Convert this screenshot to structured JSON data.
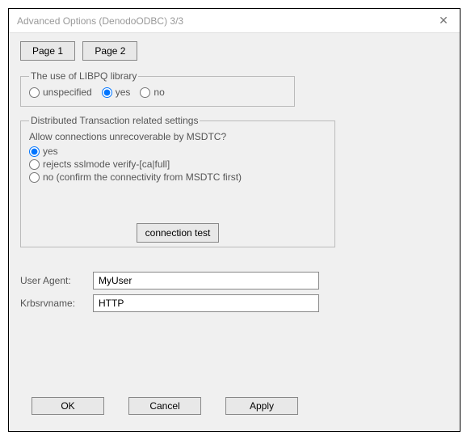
{
  "window": {
    "title": "Advanced Options (DenodoODBC) 3/3"
  },
  "pages": {
    "page1": "Page 1",
    "page2": "Page 2"
  },
  "libpq": {
    "legend": "The use of LIBPQ library",
    "opt_unspecified": "unspecified",
    "opt_yes": "yes",
    "opt_no": "no",
    "selected": "yes"
  },
  "dtc": {
    "legend": "Distributed Transaction related settings",
    "question": "Allow connections unrecoverable by MSDTC?",
    "opt_yes": "yes",
    "opt_rejects": "rejects sslmode verify-[ca|full]",
    "opt_no": "no (confirm the connectivity from MSDTC first)",
    "conn_test": "connection test",
    "selected": "yes"
  },
  "fields": {
    "user_agent_label": "User Agent:",
    "user_agent_value": "MyUser",
    "krbsrvname_label": "Krbsrvname:",
    "krbsrvname_value": "HTTP"
  },
  "buttons": {
    "ok": "OK",
    "cancel": "Cancel",
    "apply": "Apply"
  }
}
